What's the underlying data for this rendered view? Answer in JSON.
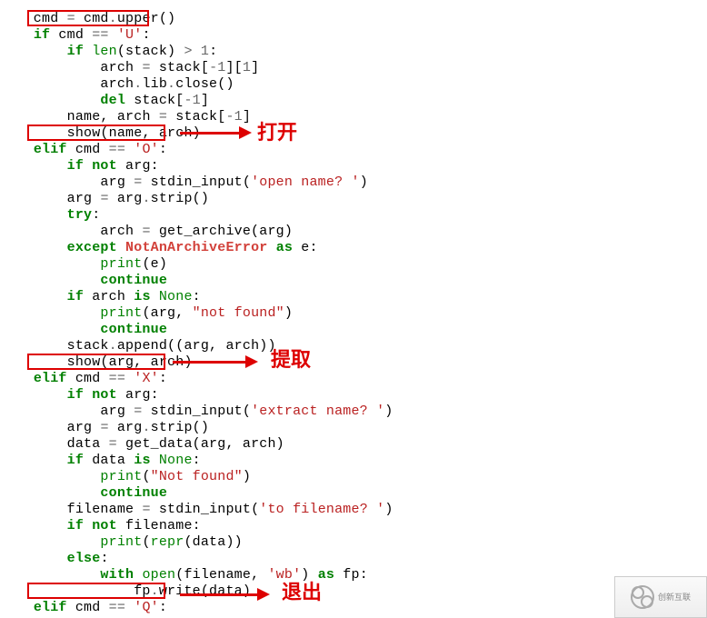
{
  "code": {
    "l0": {
      "a": "    cmd ",
      "op1": "=",
      "b": " cmd",
      "p": ".",
      "c": "upper()"
    },
    "l1": {
      "if": "if",
      "a": " cmd ",
      "eq": "==",
      "sp": " ",
      "s": "'U'",
      "c": ":"
    },
    "l2": {
      "if": "if",
      "sp": " ",
      "len": "len",
      "a": "(stack) ",
      "gt": ">",
      "sp2": " ",
      "n": "1",
      "c": ":"
    },
    "l3": {
      "a": "arch ",
      "eq": "=",
      "b": " stack[",
      "n1": "-",
      "n1b": "1",
      "c": "][",
      "n2": "1",
      "d": "]"
    },
    "l4": {
      "a": "arch",
      "p1": ".",
      "b": "lib",
      "p2": ".",
      "c": "close()"
    },
    "l5": {
      "del": "del",
      "a": " stack[",
      "n": "-",
      "nb": "1",
      "b": "]"
    },
    "l6": {
      "a": "name, arch ",
      "eq": "=",
      "b": " stack[",
      "n": "-",
      "nb": "1",
      "c": "]"
    },
    "l7": {
      "a": "show(name, arch)"
    },
    "l8": {
      "elif": "elif",
      "a": " cmd ",
      "eq": "==",
      "sp": " ",
      "s": "'O'",
      "c": ":"
    },
    "l9": {
      "if": "if",
      "sp": " ",
      "not": "not",
      "a": " arg:"
    },
    "l10": {
      "a": "arg ",
      "eq": "=",
      "b": " stdin_input(",
      "s": "'open name? '",
      "c": ")"
    },
    "l11": {
      "a": "arg ",
      "eq": "=",
      "b": " arg",
      "p": ".",
      "c": "strip()"
    },
    "l12": {
      "try": "try",
      "c": ":"
    },
    "l13": {
      "a": "arch ",
      "eq": "=",
      "b": " get_archive(arg)"
    },
    "l14": {
      "exc": "except",
      "sp": " ",
      "name": "NotAnArchiveError",
      "sp2": " ",
      "as": "as",
      "b": " e:"
    },
    "l15": {
      "pr": "print",
      "a": "(e)"
    },
    "l16": {
      "cont": "continue"
    },
    "l17": {
      "if": "if",
      "a": " arch ",
      "is": "is",
      "sp": " ",
      "none": "None",
      "c": ":"
    },
    "l18": {
      "pr": "print",
      "a": "(arg, ",
      "s": "\"not found\"",
      "b": ")"
    },
    "l19": {
      "cont": "continue"
    },
    "l20": {
      "a": "stack",
      "p": ".",
      "b": "append((arg, arch))"
    },
    "l21": {
      "a": "show(arg, arch)"
    },
    "l22": {
      "elif": "elif",
      "a": " cmd ",
      "eq": "==",
      "sp": " ",
      "s": "'X'",
      "c": ":"
    },
    "l23": {
      "if": "if",
      "sp": " ",
      "not": "not",
      "a": " arg:"
    },
    "l24": {
      "a": "arg ",
      "eq": "=",
      "b": " stdin_input(",
      "s": "'extract name? '",
      "c": ")"
    },
    "l25": {
      "a": "arg ",
      "eq": "=",
      "b": " arg",
      "p": ".",
      "c": "strip()"
    },
    "l26": {
      "a": "data ",
      "eq": "=",
      "b": " get_data(arg, arch)"
    },
    "l27": {
      "if": "if",
      "a": " data ",
      "is": "is",
      "sp": " ",
      "none": "None",
      "c": ":"
    },
    "l28": {
      "pr": "print",
      "a": "(",
      "s": "\"Not found\"",
      "b": ")"
    },
    "l29": {
      "cont": "continue"
    },
    "l30": {
      "a": "filename ",
      "eq": "=",
      "b": " stdin_input(",
      "s": "'to filename? '",
      "c": ")"
    },
    "l31": {
      "if": "if",
      "sp": " ",
      "not": "not",
      "a": " filename:"
    },
    "l32": {
      "pr": "print",
      "a": "(",
      "rp": "repr",
      "b": "(data))"
    },
    "l33": {
      "else": "else",
      "c": ":"
    },
    "l34": {
      "with": "with",
      "sp": " ",
      "open": "open",
      "a": "(filename, ",
      "s": "'wb'",
      "b": ") ",
      "as": "as",
      "c": " fp:"
    },
    "l35": {
      "a": "fp",
      "p": ".",
      "b": "write(data)"
    },
    "l36": {
      "elif": "elif",
      "a": " cmd ",
      "eq": "==",
      "sp": " ",
      "s": "'Q'",
      "c": ":"
    }
  },
  "annotations": {
    "open": "打开",
    "extract": "提取",
    "quit": "退出"
  },
  "watermark": "创新互联"
}
